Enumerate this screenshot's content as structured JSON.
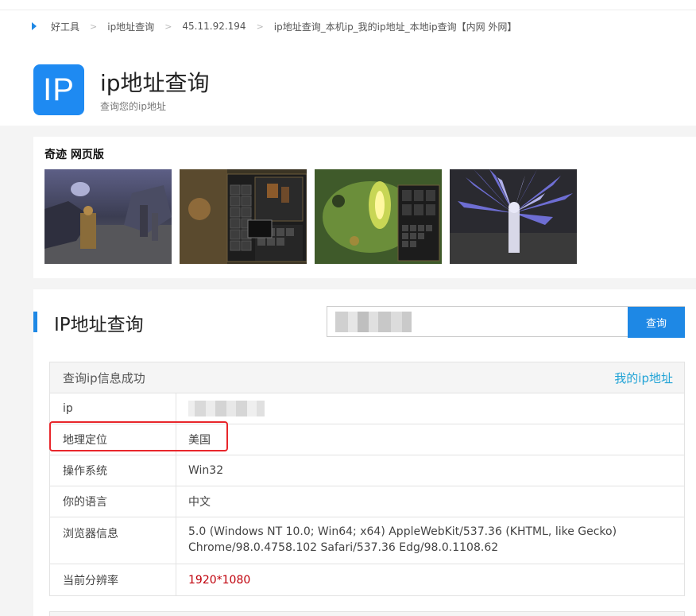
{
  "breadcrumb": {
    "items": [
      "好工具",
      "ip地址查询",
      "45.11.92.194",
      "ip地址查询_本机ip_我的ip地址_本地ip查询【内网 外网】"
    ],
    "separator": ">"
  },
  "header": {
    "logo_text": "IP",
    "title": "ip地址查询",
    "subtitle": "查询您的ip地址"
  },
  "ad": {
    "title": "奇迹 网页版",
    "thumbnails": [
      "game-screenshot-1",
      "game-screenshot-2",
      "game-screenshot-3",
      "game-screenshot-4"
    ]
  },
  "tool": {
    "section_title": "IP地址查询",
    "search_button": "查询",
    "result_status": "查询ip信息成功",
    "my_ip_link": "我的ip地址",
    "rows": [
      {
        "label": "ip",
        "value": ""
      },
      {
        "label": "地理定位",
        "value": "美国"
      },
      {
        "label": "操作系统",
        "value": "Win32"
      },
      {
        "label": "你的语言",
        "value": "中文"
      },
      {
        "label": "浏览器信息",
        "value": "5.0 (Windows NT 10.0; Win64; x64) AppleWebKit/537.36 (KHTML, like Gecko) Chrome/98.0.4758.102 Safari/537.36 Edg/98.0.1108.62"
      },
      {
        "label": "当前分辨率",
        "value": "1920*1080"
      }
    ]
  },
  "colors": {
    "accent": "#1e88e5",
    "logo_bg": "#1e8af2",
    "link": "#21a3d6",
    "resolution": "#c0000b",
    "highlight": "#e8262b"
  }
}
